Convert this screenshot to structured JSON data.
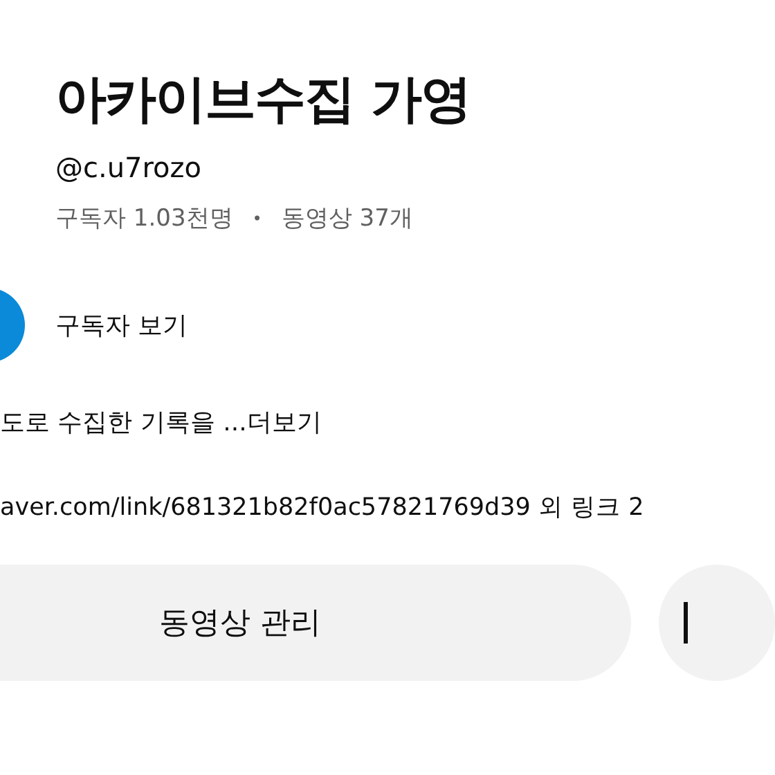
{
  "channel": {
    "name": "아카이브수집 가영",
    "handle": "@c.u7rozo",
    "subscribers": "구독자 1.03천명",
    "separator": "•",
    "videos": "동영상 37개"
  },
  "subscribers_link": {
    "label": "구독자 보기"
  },
  "description": {
    "text": "도로 수집한 기록을 ...",
    "more": "더보기"
  },
  "links": {
    "text": "aver.com/link/681321b82f0ac57821769d39 외 링크 2"
  },
  "buttons": [
    {
      "label": "동영상 관리"
    }
  ]
}
